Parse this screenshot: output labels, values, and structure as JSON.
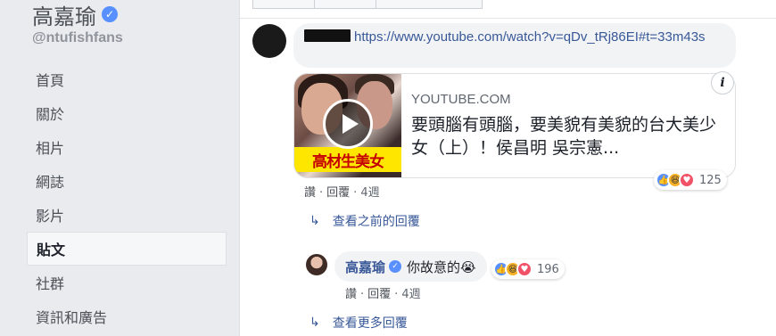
{
  "sidebar": {
    "page_name": "高嘉瑜",
    "handle": "@ntufishfans",
    "items": [
      {
        "label": "首頁"
      },
      {
        "label": "關於"
      },
      {
        "label": "相片"
      },
      {
        "label": "網誌"
      },
      {
        "label": "影片"
      },
      {
        "label": "貼文"
      },
      {
        "label": "社群"
      },
      {
        "label": "資訊和廣告"
      }
    ],
    "active_index": 5
  },
  "comment": {
    "url_text": "https://www.youtube.com/watch?v=qDv_tRj86EI#t=33m43s",
    "preview": {
      "source": "YOUTUBE.COM",
      "title": "要頭腦有頭腦，要美貌有美貌的台大美少女（上）！侯昌明 吳宗憲...",
      "thumb_caption": "高材生美女",
      "info_glyph": "i"
    },
    "actions": {
      "like": "讚",
      "reply": "回覆",
      "time": "4週"
    },
    "reaction_count": "125"
  },
  "view_previous_replies": "查看之前的回覆",
  "reply": {
    "author": "高嘉瑜",
    "text": "你故意的😭",
    "actions": {
      "like": "讚",
      "reply": "回覆",
      "time": "4週"
    },
    "reaction_count": "196"
  },
  "view_more_replies": "查看更多回覆",
  "icons": {
    "verified": "verified-badge-icon",
    "play": "play-icon",
    "info": "info-icon",
    "reply_arrow": "reply-arrow-icon"
  },
  "colors": {
    "link": "#385898",
    "verified": "#5890ff",
    "like": "#5890ff",
    "love": "#f25268",
    "haha": "#f7b125"
  }
}
